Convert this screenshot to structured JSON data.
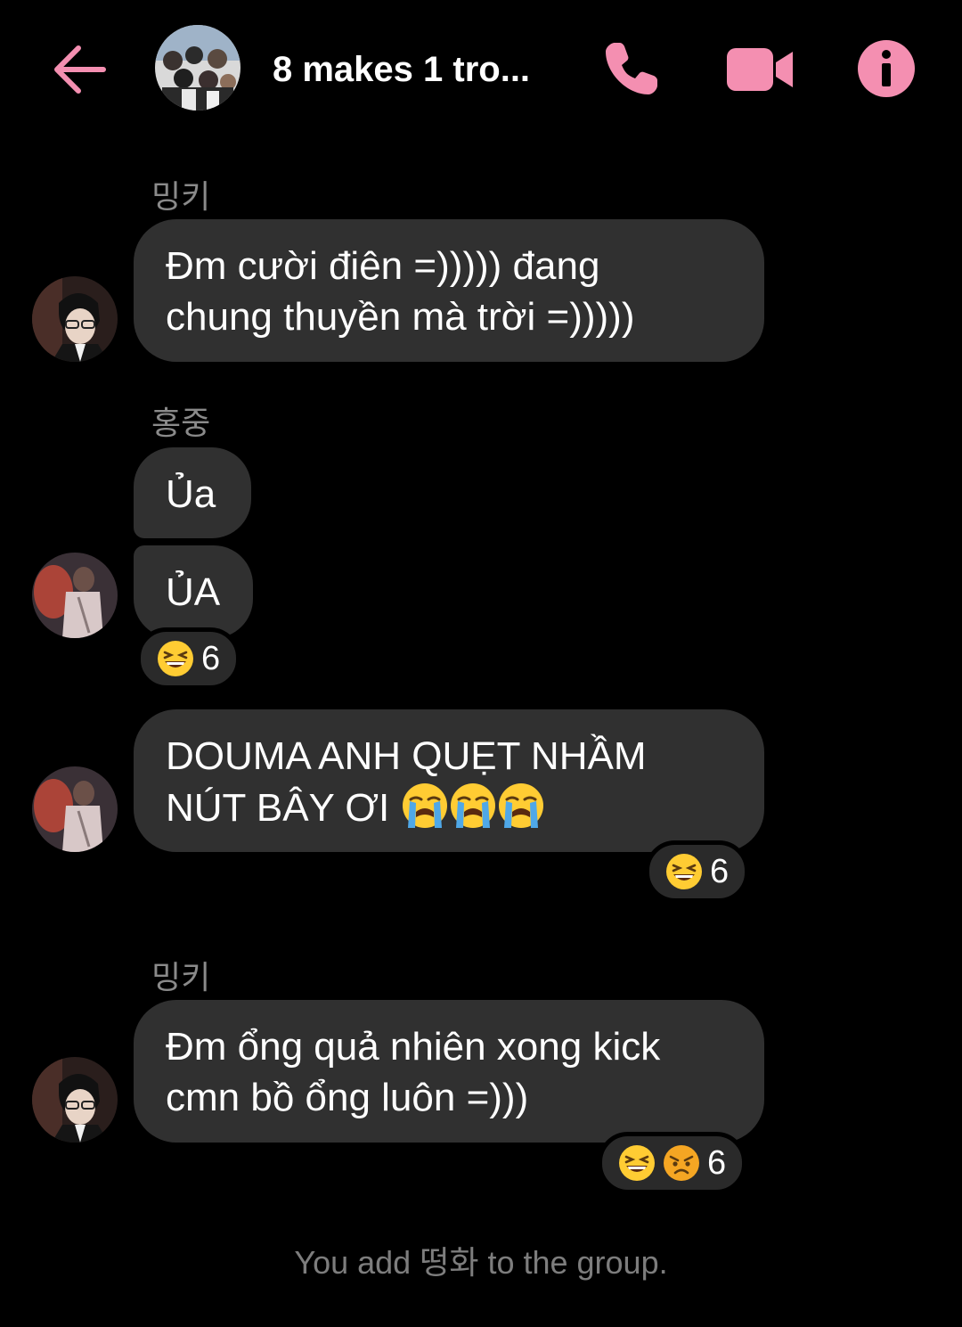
{
  "header": {
    "title": "8 makes 1 tro...",
    "accent_color": "#f48fb1",
    "icons": [
      "back-arrow-icon",
      "phone-icon",
      "video-camera-icon",
      "info-icon"
    ]
  },
  "messages": [
    {
      "sender": "밍키",
      "text_line1": "Đm cười điên =))))) đang",
      "text_line2": "chung thuyền mà trời =)))))"
    },
    {
      "sender": "홍중",
      "text": "Ủa"
    },
    {
      "text": "ỦA",
      "reaction_count": "6",
      "reaction_emojis": [
        "laughing-face-icon"
      ]
    },
    {
      "text_line1": "DOUMA ANH QUẸT NHẦM",
      "text_line2": "NÚT BÂY ƠI",
      "emojis": [
        "crying-face-icon",
        "crying-face-icon",
        "crying-face-icon"
      ],
      "reaction_count": "6",
      "reaction_emojis": [
        "laughing-face-icon"
      ]
    },
    {
      "sender": "밍키",
      "text_line1": "Đm ổng quả nhiên xong kick",
      "text_line2": "cmn bồ ổng luôn =)))",
      "reaction_count": "6",
      "reaction_emojis": [
        "laughing-face-icon",
        "angry-face-icon"
      ]
    }
  ],
  "system_message": "You add 떵화 to the group."
}
